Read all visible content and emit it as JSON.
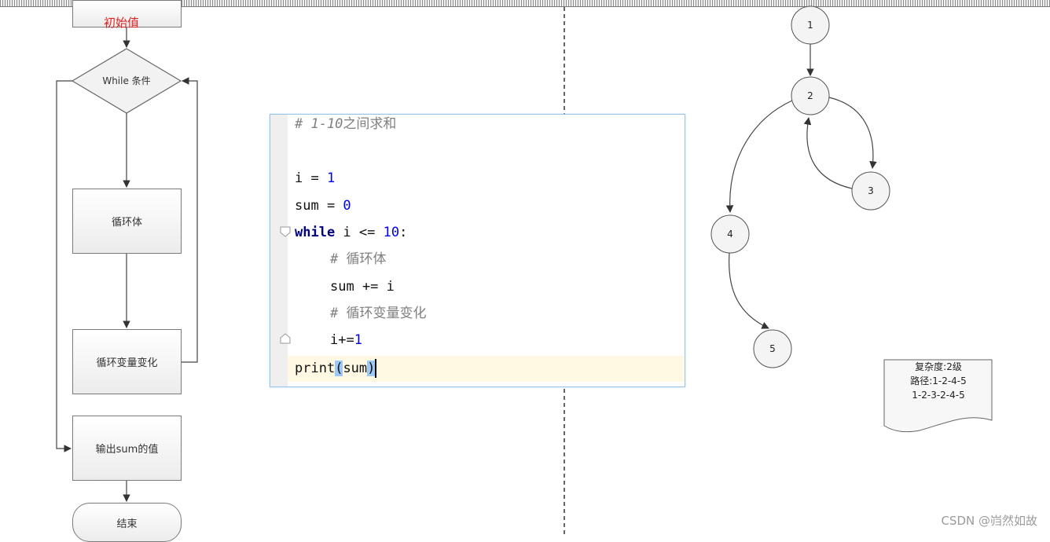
{
  "flowchart": {
    "init_label": "初始值",
    "while_label": "While 条件",
    "loop_body": "循环体",
    "loop_var_change": "循环变量变化",
    "output": "输出sum的值",
    "end": "结束"
  },
  "code": {
    "comment_prefix": "# 1-10",
    "comment_cn": "之间求和",
    "l1_var": "i = ",
    "l1_num": "1",
    "l2_var": "sum = ",
    "l2_num": "0",
    "l3_kw": "while",
    "l3_mid": " i <= ",
    "l3_num": "10",
    "l3_colon": ":",
    "c1_hash": "# ",
    "c1_text": "循环体",
    "l4": "sum += i",
    "c2_hash": "# ",
    "c2_text": "循环变量变化",
    "l5_var": "i+=",
    "l5_num": "1",
    "l6_func": "print",
    "l6_open": "(",
    "l6_arg": "sum",
    "l6_close": ")"
  },
  "graph": {
    "nodes": [
      "1",
      "2",
      "3",
      "4",
      "5"
    ]
  },
  "note": {
    "complexity": "复杂度:2级",
    "paths_label": "路径:1-2-4-5",
    "path2": "1-2-3-2-4-5"
  },
  "watermark": "CSDN @岿然如故",
  "colors": {
    "init_label": "#dd2222",
    "code_border": "#9cc3e8",
    "highlight_line": "#fff8e3"
  }
}
